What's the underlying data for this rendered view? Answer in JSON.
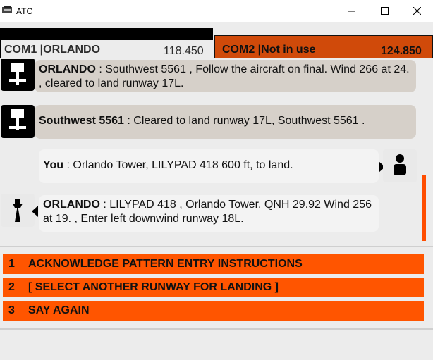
{
  "window": {
    "title": "ATC",
    "controls": [
      "minimize-icon",
      "maximize-icon",
      "close-icon"
    ]
  },
  "com1": {
    "label": "COM1 |ORLANDO",
    "freq": "118.450"
  },
  "com2": {
    "label": "COM2 |Not in use",
    "freq": "124.850"
  },
  "messages": [
    {
      "speaker": "ORLANDO",
      "text": " : Southwest 5561 , Follow the aircraft on final. Wind 266 at 24. , cleared to land runway 17L."
    },
    {
      "speaker": "Southwest 5561",
      "text": " : Cleared to land runway 17L, Southwest 5561 ."
    },
    {
      "speaker": "You",
      "text": " : Orlando Tower, LILYPAD 418 600 ft, to land."
    },
    {
      "speaker": "ORLANDO",
      "text": " : LILYPAD 418 , Orlando Tower. QNH 29.92 Wind 256 at 19. , Enter left downwind runway 18L."
    }
  ],
  "options": [
    {
      "num": "1",
      "label": "ACKNOWLEDGE PATTERN ENTRY INSTRUCTIONS"
    },
    {
      "num": "2",
      "label": "[ SELECT ANOTHER RUNWAY FOR LANDING ]"
    },
    {
      "num": "3",
      "label": "SAY AGAIN"
    }
  ],
  "colors": {
    "accent": "#ff5500",
    "com2": "#d04a0a",
    "bubble": "#d6d0c9",
    "panel": "#ececec"
  }
}
